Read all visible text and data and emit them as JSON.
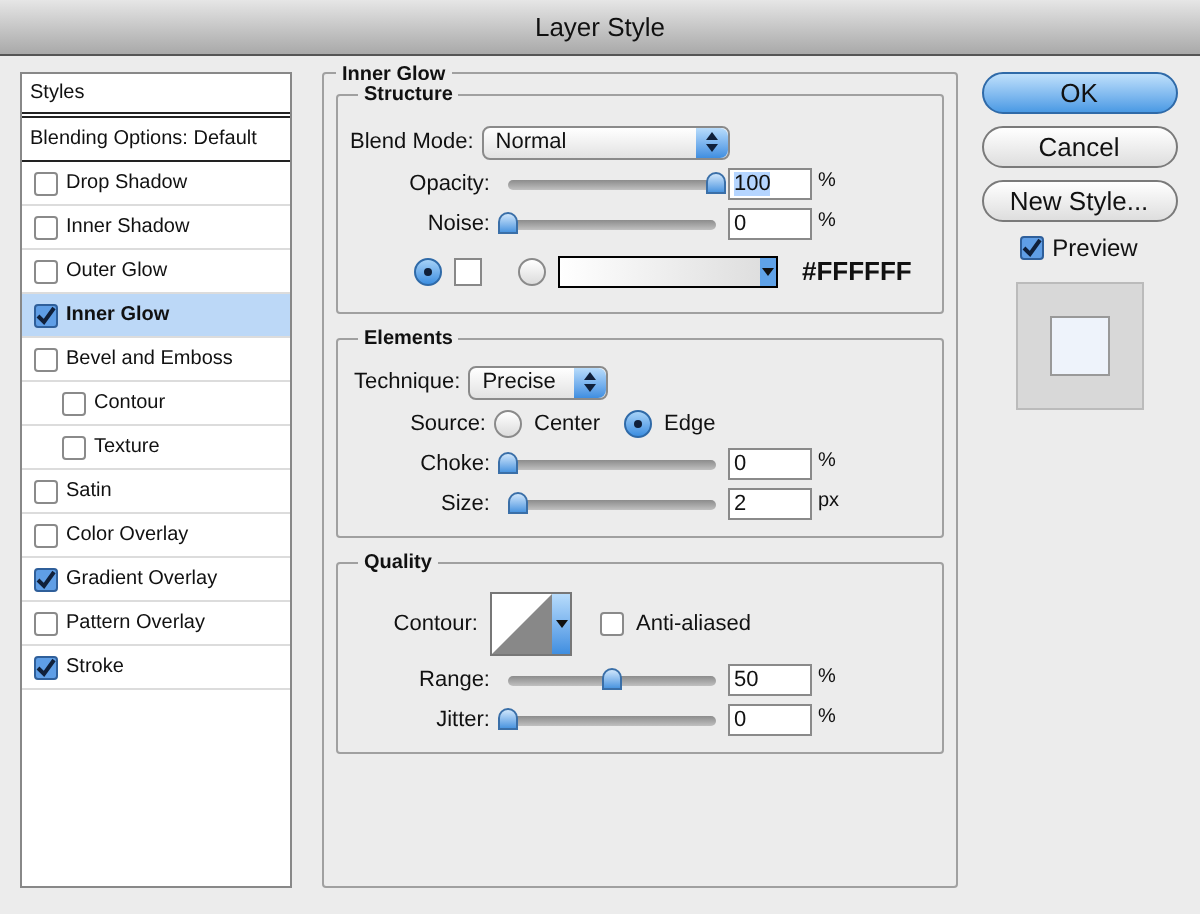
{
  "window": {
    "title": "Layer Style"
  },
  "sidebar": {
    "header": "Styles",
    "blending": "Blending Options: Default",
    "items": [
      {
        "label": "Drop Shadow",
        "checked": false,
        "selected": false
      },
      {
        "label": "Inner Shadow",
        "checked": false,
        "selected": false
      },
      {
        "label": "Outer Glow",
        "checked": false,
        "selected": false
      },
      {
        "label": "Inner Glow",
        "checked": true,
        "selected": true
      },
      {
        "label": "Bevel and Emboss",
        "checked": false,
        "selected": false,
        "children": [
          {
            "label": "Contour",
            "checked": false,
            "selected": false
          },
          {
            "label": "Texture",
            "checked": false,
            "selected": false
          }
        ]
      },
      {
        "label": "Satin",
        "checked": false,
        "selected": false
      },
      {
        "label": "Color Overlay",
        "checked": false,
        "selected": false
      },
      {
        "label": "Gradient Overlay",
        "checked": true,
        "selected": false
      },
      {
        "label": "Pattern Overlay",
        "checked": false,
        "selected": false
      },
      {
        "label": "Stroke",
        "checked": true,
        "selected": false
      }
    ]
  },
  "panel": {
    "title": "Inner Glow",
    "structure": {
      "title": "Structure",
      "blend_mode": {
        "label": "Blend Mode:",
        "value": "Normal"
      },
      "sliders": [
        {
          "label": "Opacity:",
          "level": 1.0,
          "value": "100",
          "unit": "%",
          "value_selected": true
        },
        {
          "label": "Noise:",
          "level": 0,
          "value": "0",
          "unit": "%",
          "value_selected": false
        }
      ],
      "color_radio": {
        "selected": true
      },
      "gradient_radio": {
        "selected": false
      },
      "hex": "#FFFFFF"
    },
    "elements": {
      "title": "Elements",
      "technique": {
        "label": "Technique:",
        "value": "Precise"
      },
      "source": {
        "label": "Source:",
        "options": [
          {
            "label": "Center",
            "selected": false
          },
          {
            "label": "Edge",
            "selected": true
          }
        ]
      },
      "sliders": [
        {
          "label": "Choke:",
          "level": 0,
          "value": "0",
          "unit": "%",
          "value_selected": false
        },
        {
          "label": "Size:",
          "level": 0.05,
          "value": "2",
          "unit": "px",
          "value_selected": false
        }
      ]
    },
    "quality": {
      "title": "Quality",
      "contour_label": "Contour:",
      "anti_aliased": {
        "label": "Anti-aliased",
        "checked": false
      },
      "sliders": [
        {
          "label": "Range:",
          "level": 0.5,
          "value": "50",
          "unit": "%",
          "value_selected": false
        },
        {
          "label": "Jitter:",
          "level": 0,
          "value": "0",
          "unit": "%",
          "value_selected": false
        }
      ]
    }
  },
  "buttons": [
    {
      "label": "OK",
      "kind": "default"
    },
    {
      "label": "Cancel",
      "kind": "normal"
    },
    {
      "label": "New Style...",
      "kind": "normal"
    }
  ],
  "preview": {
    "label": "Preview",
    "checked": true
  }
}
